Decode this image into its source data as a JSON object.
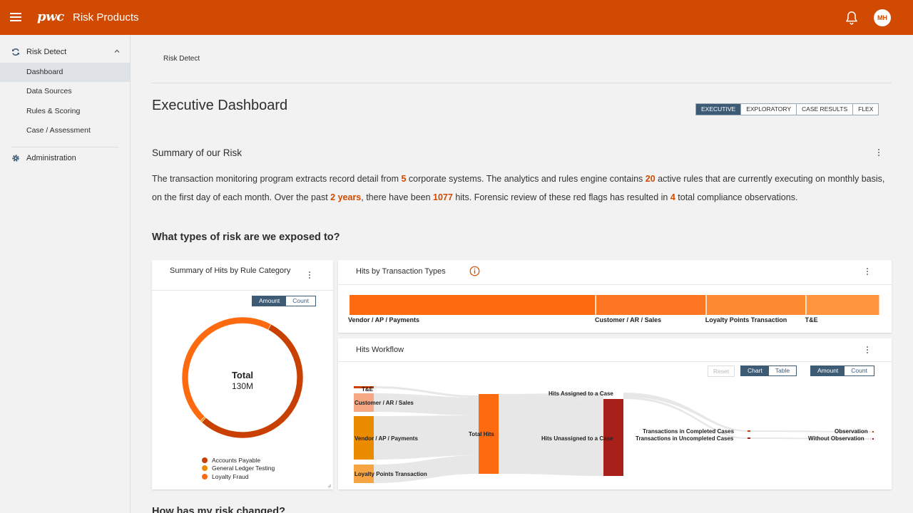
{
  "header": {
    "logo": "pwc",
    "app_title": "Risk Products",
    "avatar_initials": "MH",
    "brand_color": "#d04a02"
  },
  "sidebar": {
    "group_risk_detect": "Risk Detect",
    "items": [
      {
        "label": "Dashboard"
      },
      {
        "label": "Data Sources"
      },
      {
        "label": "Rules & Scoring"
      },
      {
        "label": "Case / Assessment"
      }
    ],
    "group_admin": "Administration"
  },
  "breadcrumb": "Risk Detect",
  "page_title": "Executive Dashboard",
  "view_tabs": [
    "EXECUTIVE",
    "EXPLORATORY",
    "CASE RESULTS",
    "FLEX"
  ],
  "summary": {
    "title": "Summary of our Risk",
    "t1": "The transaction monitoring program extracts record detail from ",
    "v1": "5",
    "t2": " corporate systems. The analytics and rules engine contains ",
    "v2": "20",
    "t3": " active rules that are currently executing on monthly basis, on the first day of each month. Over the past ",
    "v3": "2 years",
    "t4": ", there have been ",
    "v4": "1077",
    "t5": " hits. Forensic review of these red flags has resulted in ",
    "v5": "4",
    "t6": " total compliance observations."
  },
  "question1": "What types of risk are we exposed to?",
  "question2": "How has my risk changed?",
  "rule_card": {
    "title": "Summary of Hits by Rule Category",
    "toggle": [
      "Amount",
      "Count"
    ],
    "center_label": "Total",
    "center_value": "130M"
  },
  "tx_card": {
    "title": "Hits by Transaction Types"
  },
  "workflow_card": {
    "title": "Hits Workflow",
    "reset": "Reset",
    "view_toggle": [
      "Chart",
      "Table"
    ],
    "measure_toggle": [
      "Amount",
      "Count"
    ]
  },
  "chart_data": [
    {
      "type": "pie",
      "title": "Summary of Hits by Rule Category",
      "total_label": "Total",
      "total": "130M",
      "slices": [
        {
          "name": "Accounts Payable",
          "value": 0.54,
          "color": "#c94102"
        },
        {
          "name": "General Ledger Testing",
          "value": 0.005,
          "color": "#eb8c00"
        },
        {
          "name": "Loyalty Fraud",
          "value": 0.455,
          "color": "#fe6a10"
        }
      ],
      "legend": "bottom"
    },
    {
      "type": "bar",
      "title": "Hits by Transaction Types",
      "orientation": "horizontal-stacked",
      "categories": [
        "Vendor / AP / Payments",
        "Customer / AR / Sales",
        "Loyalty Points Transaction",
        "T&E"
      ],
      "values": [
        0.465,
        0.208,
        0.188,
        0.139
      ],
      "colors": [
        "#fe6a10",
        "#fe7522",
        "#ff8a34",
        "#ff953f"
      ]
    },
    {
      "type": "sankey",
      "title": "Hits Workflow",
      "nodes": [
        {
          "name": "T&E",
          "color": "#c94102"
        },
        {
          "name": "Customer / AR / Sales",
          "color": "#f6a784"
        },
        {
          "name": "Vendor / AP / Payments",
          "color": "#eb8c00"
        },
        {
          "name": "Loyalty Points Transaction",
          "color": "#f7a443"
        },
        {
          "name": "Total Hits",
          "color": "#fe6a10"
        },
        {
          "name": "Hits Assigned to a Case",
          "color": "#c94102"
        },
        {
          "name": "Hits Unassigned to a Case",
          "color": "#a8201a"
        },
        {
          "name": "Transactions in Completed Cases",
          "color": "#c94102"
        },
        {
          "name": "Transactions in Uncompleted Cases",
          "color": "#a8201a"
        },
        {
          "name": "Observation",
          "color": "#c94102"
        },
        {
          "name": "Without Observation",
          "color": "#a8201a"
        }
      ]
    }
  ]
}
